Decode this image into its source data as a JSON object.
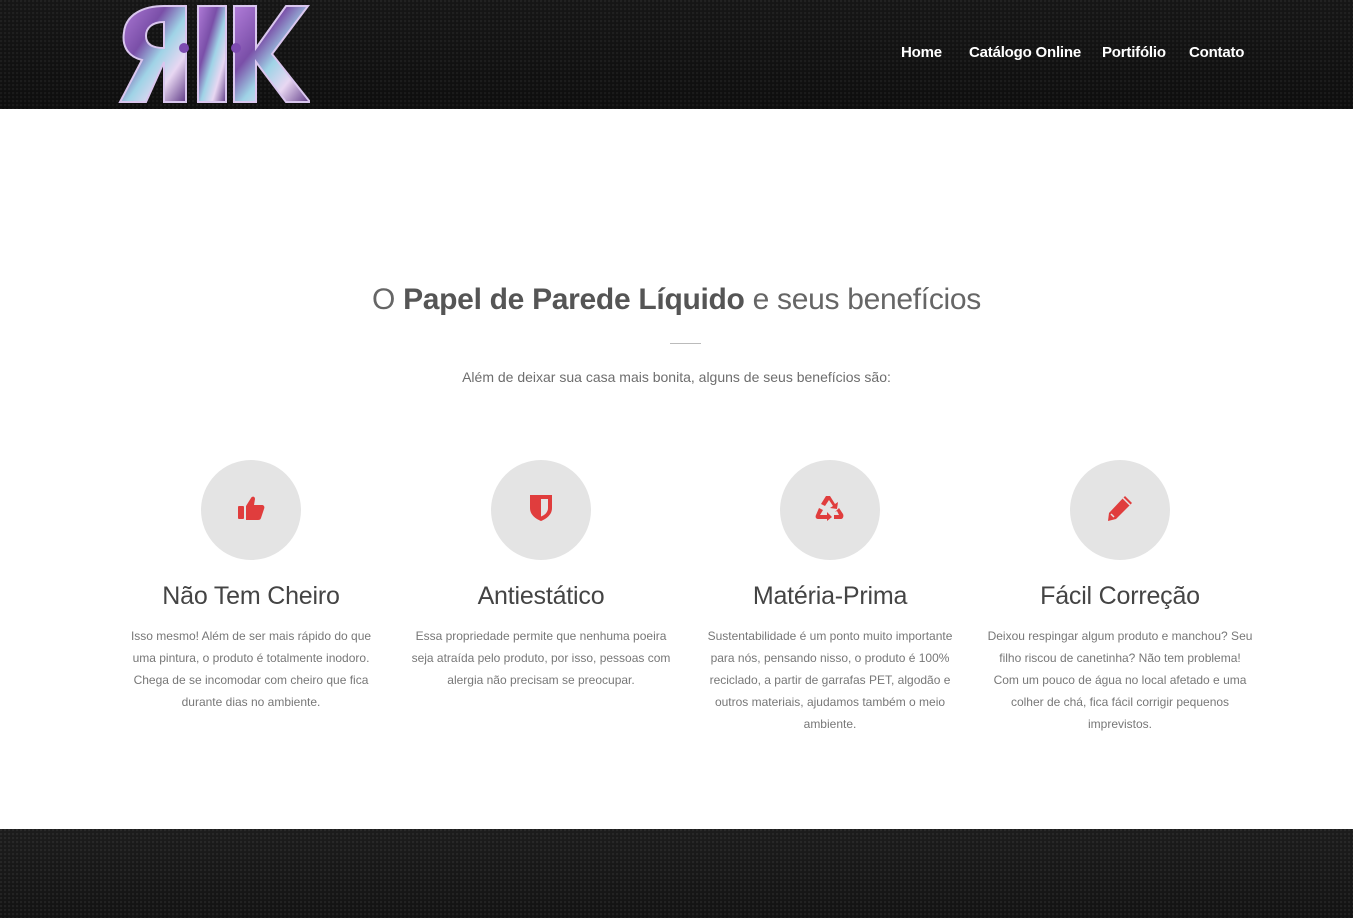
{
  "header": {
    "logo_text": "RK",
    "nav": [
      {
        "label": "Home"
      },
      {
        "label": "Catálogo Online"
      },
      {
        "label": "Portifólio"
      },
      {
        "label": "Contato"
      }
    ]
  },
  "section": {
    "title_pre": "O ",
    "title_bold": "Papel de Parede Líquido",
    "title_post": " e seus benefícios",
    "subtitle": "Além de deixar sua casa mais bonita, alguns de seus benefícios são:"
  },
  "features": [
    {
      "icon": "thumbs-up-icon",
      "title": "Não Tem Cheiro",
      "text": "Isso mesmo! Além de ser mais rápido do que uma pintura, o produto é totalmente inodoro. Chega de se incomodar com cheiro que fica durante dias no ambiente."
    },
    {
      "icon": "shield-icon",
      "title": "Antiestático",
      "text": "Essa propriedade permite que nenhuma poeira seja atraída pelo produto, por isso, pessoas com alergia não precisam se preocupar."
    },
    {
      "icon": "recycle-icon",
      "title": "Matéria-Prima",
      "text": "Sustentabilidade é um ponto muito importante para nós, pensando nisso, o produto é 100% reciclado, a partir de garrafas PET, algodão e outros materiais, ajudamos também o meio ambiente."
    },
    {
      "icon": "pencil-icon",
      "title": "Fácil Correção",
      "text": "Deixou respingar algum produto e manchou? Seu filho riscou de canetinha? Não tem problema! Com um pouco de água no local afetado e uma colher de chá, fica fácil corrigir pequenos imprevistos."
    }
  ],
  "colors": {
    "accent": "#e03d3d",
    "circle": "#e4e4e4",
    "header_bg": "#111111"
  }
}
